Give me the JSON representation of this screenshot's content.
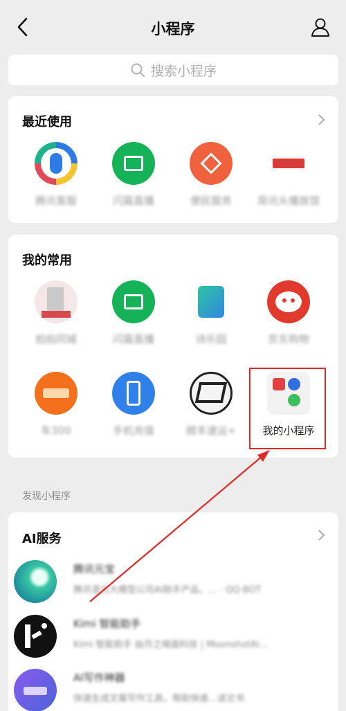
{
  "nav": {
    "title": "小程序",
    "back_icon": "chevron-left-icon",
    "user_icon": "person-icon"
  },
  "search": {
    "placeholder": "搜索小程序",
    "icon": "search-icon"
  },
  "recent": {
    "title": "最近使用",
    "items": [
      {
        "label": "腾讯客服",
        "icon": "tencent-service-icon",
        "color": "#2e7be6"
      },
      {
        "label": "闪篇直播",
        "icon": "green-chart-icon",
        "color": "#16b257"
      },
      {
        "label": "便民服务",
        "icon": "orange-home-icon",
        "color": "#f0623e"
      },
      {
        "label": "简讯头播放馆",
        "icon": "red-banner-icon",
        "color": "#d93a3a"
      }
    ]
  },
  "favorites": {
    "title": "我的常用",
    "items": [
      {
        "label": "拍拍同城",
        "icon": "red-building-icon",
        "color": "#d84a4a"
      },
      {
        "label": "闪篇直播",
        "icon": "green-chart-icon",
        "color": "#16b257"
      },
      {
        "label": "诗乐园",
        "icon": "blue-green-tile-icon",
        "color": "#29a8c6"
      },
      {
        "label": "京东购物",
        "icon": "red-face-icon",
        "color": "#e2392d"
      },
      {
        "label": "车300",
        "icon": "orange-badge-icon",
        "color": "#f4701c"
      },
      {
        "label": "手机充值",
        "icon": "blue-phone-icon",
        "color": "#2f80e8"
      },
      {
        "label": "顺丰速运+",
        "icon": "sf-logo-icon",
        "color": "#222222"
      },
      {
        "label": "我的小程序",
        "icon": "folder-grid-icon",
        "color": "#f2f2f2"
      }
    ]
  },
  "discover": {
    "label": "发现小程序"
  },
  "ai": {
    "title": "AI服务",
    "items": [
      {
        "name": "腾讯元宝",
        "desc": "腾讯混元大模型公司AI助手产品，…  ·  QQ·BOT",
        "color": "#1fa98a"
      },
      {
        "name": "Kimi 智能助手",
        "desc": "Kimi 智能助手 由月之暗面科技 | MoonshotAI…",
        "color": "#111111"
      },
      {
        "name": "AI写作神器",
        "desc": "快速生成文案写作工具，帮助快速…读文书",
        "color": "#6b56d8"
      }
    ]
  },
  "annotation": {
    "highlight_color": "#e02a2a"
  }
}
